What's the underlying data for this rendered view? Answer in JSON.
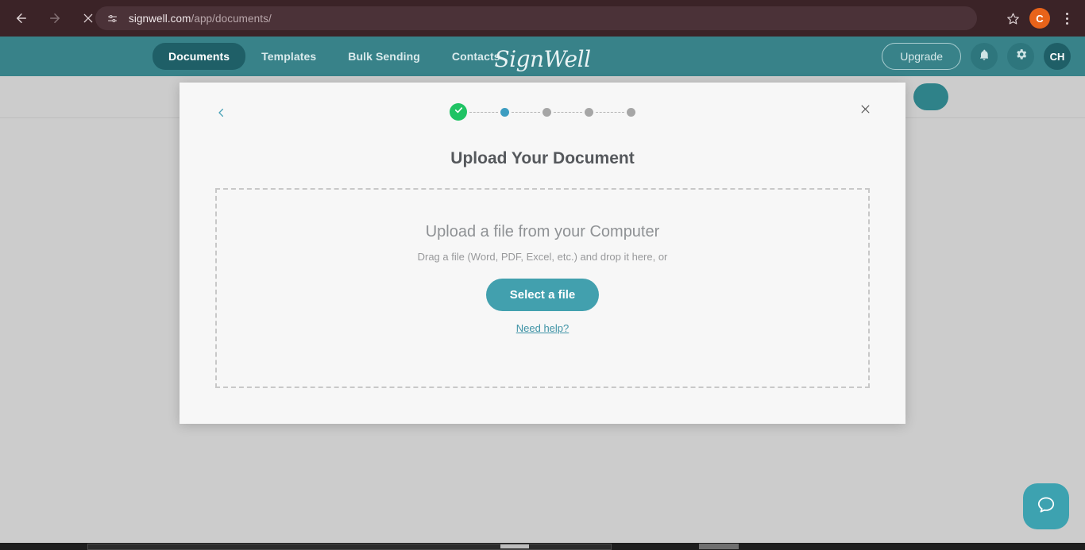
{
  "browser": {
    "url_host": "signwell.com",
    "url_path": "/app/documents/",
    "back_icon": "back-arrow-icon",
    "forward_icon": "forward-arrow-icon",
    "stop_icon": "stop-loading-icon",
    "site_info_icon": "site-settings-icon",
    "bookmark_icon": "star-icon",
    "profile_initial": "C",
    "menu_icon": "kebab-menu-icon"
  },
  "app_nav": {
    "brand": "SignWell",
    "links": [
      {
        "label": "Documents",
        "active": true
      },
      {
        "label": "Templates",
        "active": false
      },
      {
        "label": "Bulk Sending",
        "active": false
      },
      {
        "label": "Contacts",
        "active": false
      }
    ],
    "upgrade_label": "Upgrade",
    "notifications_icon": "bell-icon",
    "settings_icon": "gear-icon",
    "user_initials": "CH",
    "bg_color": "#388289",
    "active_bg_color": "#1f5f67"
  },
  "modal": {
    "back_icon": "chevron-left-icon",
    "close_icon": "close-icon",
    "title": "Upload Your Document",
    "steps": [
      {
        "state": "done",
        "icon": "check-icon",
        "color": "#20c364"
      },
      {
        "state": "current",
        "color": "#3d9dc1"
      },
      {
        "state": "todo",
        "color": "#a6a6a6"
      },
      {
        "state": "todo",
        "color": "#a6a6a6"
      },
      {
        "state": "todo",
        "color": "#a6a6a6"
      }
    ],
    "dropzone": {
      "heading": "Upload a file from your Computer",
      "subtext": "Drag a file (Word, PDF, Excel, etc.) and drop it here, or",
      "button_label": "Select a file",
      "help_link": "Need help?",
      "button_color": "#42a0ae",
      "link_color": "#3f93a6"
    }
  },
  "help_widget": {
    "icon": "chat-bubble-icon",
    "color": "#3da2b0"
  }
}
